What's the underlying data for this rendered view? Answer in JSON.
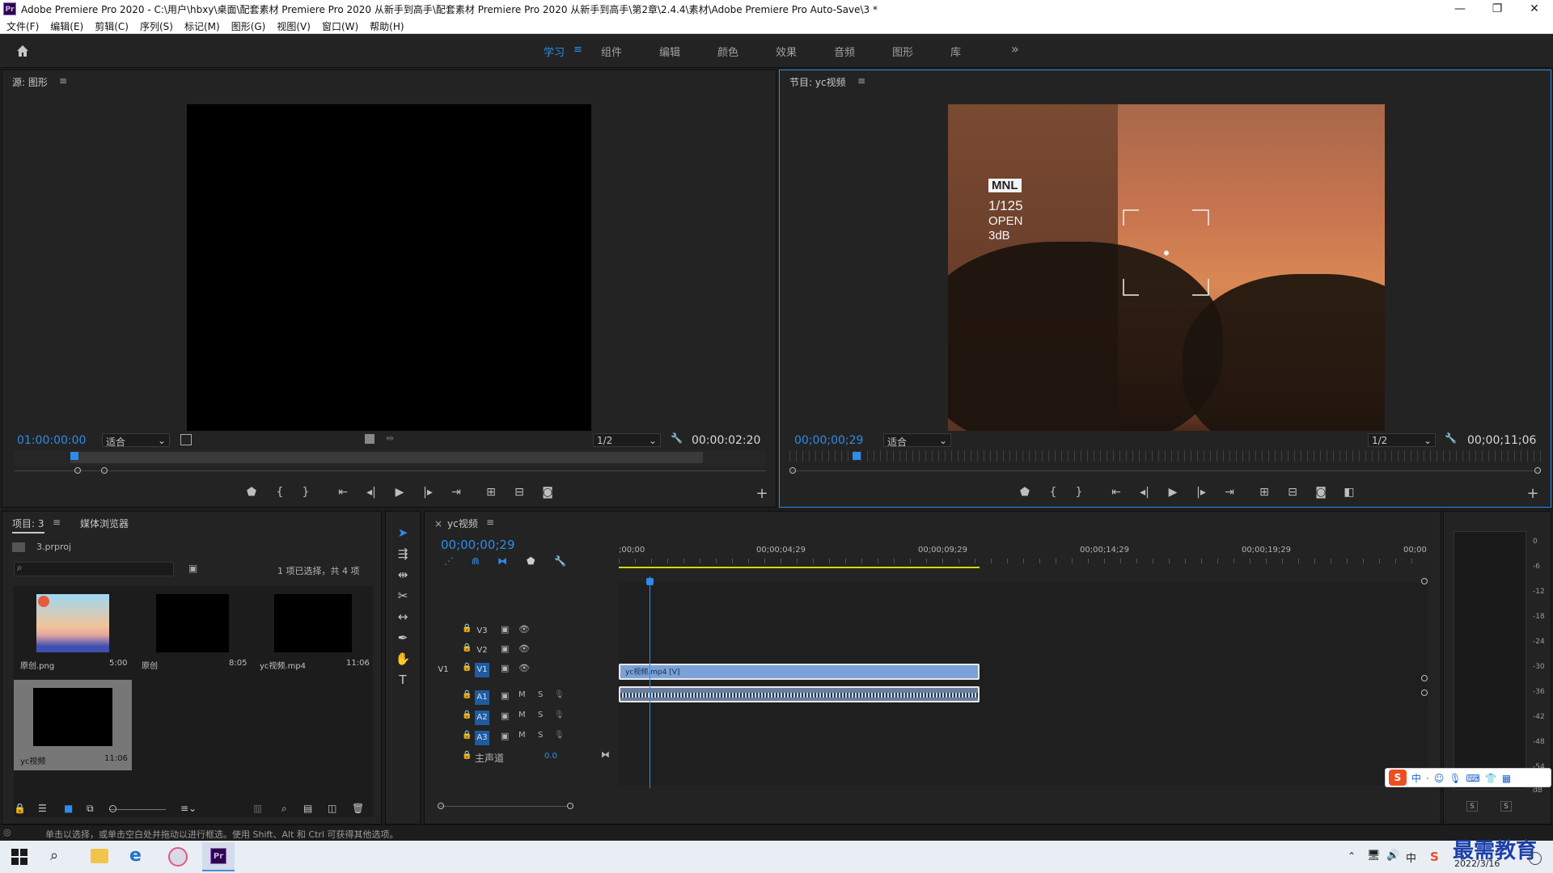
{
  "window": {
    "app_icon": "Pr",
    "title": "Adobe Premiere Pro 2020 - C:\\用户\\hbxy\\桌面\\配套素材 Premiere Pro 2020 从新手到高手\\配套素材 Premiere Pro 2020 从新手到高手\\第2章\\2.4.4\\素材\\Adobe Premiere Pro Auto-Save\\3 *",
    "minimize": "—",
    "maximize": "❐",
    "close": "✕"
  },
  "menu": [
    "文件(F)",
    "编辑(E)",
    "剪辑(C)",
    "序列(S)",
    "标记(M)",
    "图形(G)",
    "视图(V)",
    "窗口(W)",
    "帮助(H)"
  ],
  "workspaces": {
    "items": [
      "学习",
      "组件",
      "编辑",
      "颜色",
      "效果",
      "音频",
      "图形",
      "库"
    ],
    "active": "学习",
    "more": "»"
  },
  "source": {
    "title": "源: 图形",
    "timecode": "01:00:00:00",
    "fit": "适合",
    "resolution": "1/2",
    "duration": "00:00:02:20"
  },
  "program": {
    "title": "节目: yc视频",
    "timecode": "00;00;00;29",
    "fit": "适合",
    "resolution": "1/2",
    "duration": "00;00;11;06",
    "overlay": {
      "mode": "MNL",
      "shutter": "1/125",
      "aperture": "OPEN",
      "gain": "3dB"
    }
  },
  "project": {
    "tabs": [
      "项目: 3",
      "媒体浏览器"
    ],
    "file": "3.prproj",
    "selection_info": "1 项已选择，共 4 项",
    "items": [
      {
        "name": "原创.png",
        "duration": "5:00"
      },
      {
        "name": "原创",
        "duration": "8:05"
      },
      {
        "name": "yc视频.mp4",
        "duration": "11:06"
      },
      {
        "name": "yc视频",
        "duration": "11:06"
      }
    ]
  },
  "timeline": {
    "title": "yc视频",
    "timecode": "00;00;00;29",
    "ruler": [
      ";00;00",
      "00;00;04;29",
      "00;00;09;29",
      "00;00;14;29",
      "00;00;19;29",
      "00;00"
    ],
    "video_tracks": [
      "V3",
      "V2",
      "V1"
    ],
    "source_patch": "V1",
    "audio_tracks": [
      "A1",
      "A2",
      "A3"
    ],
    "m_label": "M",
    "s_label": "S",
    "master": {
      "label": "主声道",
      "value": "0.0"
    },
    "clip_video": "yc视频.mp4 [V]"
  },
  "meter": {
    "scale": [
      "0",
      "-6",
      "-12",
      "-18",
      "-24",
      "-30",
      "-36",
      "-42",
      "-48",
      "-54",
      "dB"
    ],
    "solo": [
      "S",
      "S"
    ]
  },
  "status_bar": "单击以选择，或单击空白处并拖动以进行框选。使用 Shift、Alt 和 Ctrl 可获得其他选项。",
  "taskbar": {
    "date": "2022/3/16",
    "watermark": "最需教育"
  },
  "colors": {
    "accent": "#2d8ceb",
    "clip": "#6b93cc",
    "workarea": "#d8d800",
    "bg": "#1d1d1d"
  }
}
